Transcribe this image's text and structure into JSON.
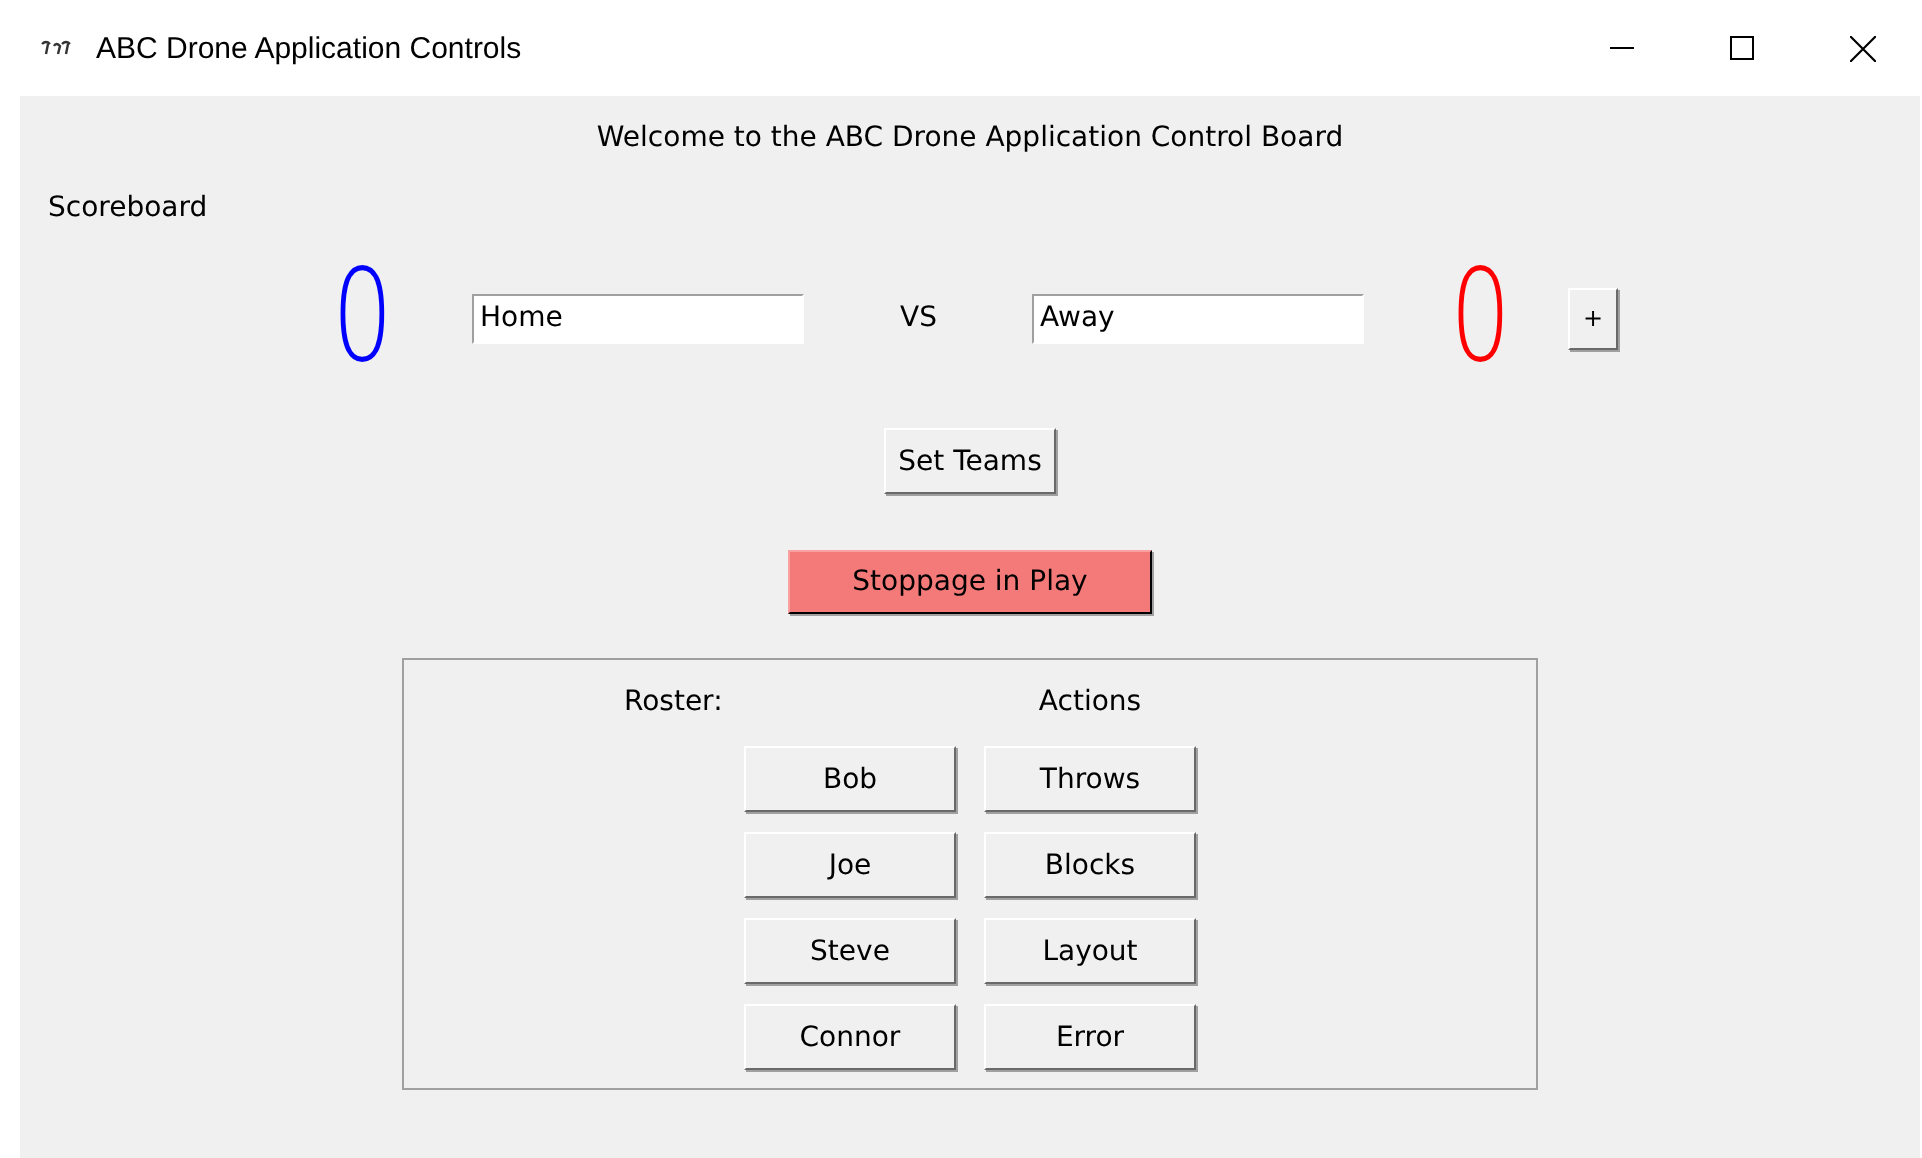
{
  "window": {
    "title": "ABC Drone Application Controls"
  },
  "welcome": "Welcome to the ABC Drone Application Control Board",
  "scoreboard": {
    "label": "Scoreboard",
    "home": {
      "score": "0",
      "color": "#0000ff",
      "team": "Home"
    },
    "vs": "VS",
    "away": {
      "score": "0",
      "color": "#ff0000",
      "team": "Away"
    },
    "plus_button": "+"
  },
  "set_teams_button": "Set Teams",
  "stoppage_button": "Stoppage in Play",
  "panel": {
    "roster_label": "Roster:",
    "actions_label": "Actions",
    "roster": [
      "Bob",
      "Joe",
      "Steve",
      "Connor"
    ],
    "actions": [
      "Throws",
      "Blocks",
      "Layout",
      "Error"
    ]
  }
}
